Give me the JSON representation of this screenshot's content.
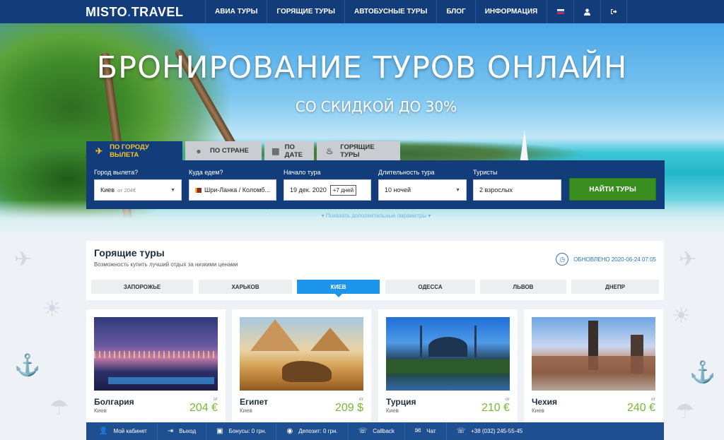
{
  "brand": {
    "name_left": "MISTO",
    "name_dot": ".",
    "name_right": "TRAVEL"
  },
  "nav": {
    "items": [
      "АВИА ТУРЫ",
      "ГОРЯЩИЕ ТУРЫ",
      "АВТОБУСНЫЕ ТУРЫ",
      "БЛОГ",
      "ИНФОРМАЦИЯ"
    ],
    "icons": [
      "flag-ru-icon",
      "user-icon",
      "logout-icon"
    ]
  },
  "hero": {
    "title": "БРОНИРОВАНИЕ ТУРОВ ОНЛАЙН",
    "subtitle": "СО СКИДКОЙ ДО 30%"
  },
  "search": {
    "tabs": [
      {
        "label": "ПО ГОРОДУ ВЫЛЕТА",
        "icon": "plane-icon"
      },
      {
        "label": "ПО СТРАНЕ",
        "icon": "location-pin-icon"
      },
      {
        "label": "ПО ДАТЕ",
        "icon": "calendar-icon"
      },
      {
        "label": "ГОРЯЩИЕ ТУРЫ",
        "icon": "flame-icon"
      }
    ],
    "departure_label": "Город вылета?",
    "departure_value": "Киев",
    "departure_note": "от 204€",
    "destination_label": "Куда едем?",
    "destination_value": "Шри-Ланка / Коломб...",
    "start_label": "Начало тура",
    "start_value": "19 дек. 2020",
    "start_badge": "+7 дней",
    "duration_label": "Длительность тура",
    "duration_value": "10 ночей",
    "tourists_label": "Туристы",
    "tourists_value": "2 взрослых",
    "submit_label": "НАЙТИ ТУРЫ",
    "more_params": "▾ Показать дополнительные параметры ▾"
  },
  "hot_tours": {
    "title": "Горящие туры",
    "subtitle": "Возможность купить лучший отдых за низкими ценами",
    "updated": "ОБНОВЛЕНО 2020-06-24 07:05",
    "cities": [
      "ЗАПОРОЖЬЕ",
      "ХАРЬКОВ",
      "КИЕВ",
      "ОДЕССА",
      "ЛЬВОВ",
      "ДНЕПР"
    ],
    "active_city": "КИЕВ",
    "cards": [
      {
        "country": "Болгария",
        "city": "Киев",
        "from": "от",
        "price": "204 €"
      },
      {
        "country": "Египет",
        "city": "Киев",
        "from": "от",
        "price": "209 $"
      },
      {
        "country": "Турция",
        "city": "Киев",
        "from": "от",
        "price": "210 €"
      },
      {
        "country": "Чехия",
        "city": "Киев",
        "from": "от",
        "price": "240 €"
      }
    ]
  },
  "bottom_bar": {
    "items": [
      {
        "label": "Мой кабинет",
        "icon": "user-icon"
      },
      {
        "label": "Выход",
        "icon": "logout-icon"
      },
      {
        "label": "Бонусы: 0 грн.",
        "icon": "gift-icon"
      },
      {
        "label": "Депозит: 0 грн.",
        "icon": "coin-icon"
      },
      {
        "label": "Callback",
        "icon": "phone-icon"
      },
      {
        "label": "Чат",
        "icon": "chat-icon"
      },
      {
        "label": "+38 (032) 245-55-45",
        "icon": "phone-icon"
      }
    ]
  },
  "colors": {
    "nav_bg": "#123d7a",
    "accent": "#1e95ec",
    "button": "#3a8e20",
    "price": "#7ab833",
    "tab_active_text": "#f4c430"
  }
}
